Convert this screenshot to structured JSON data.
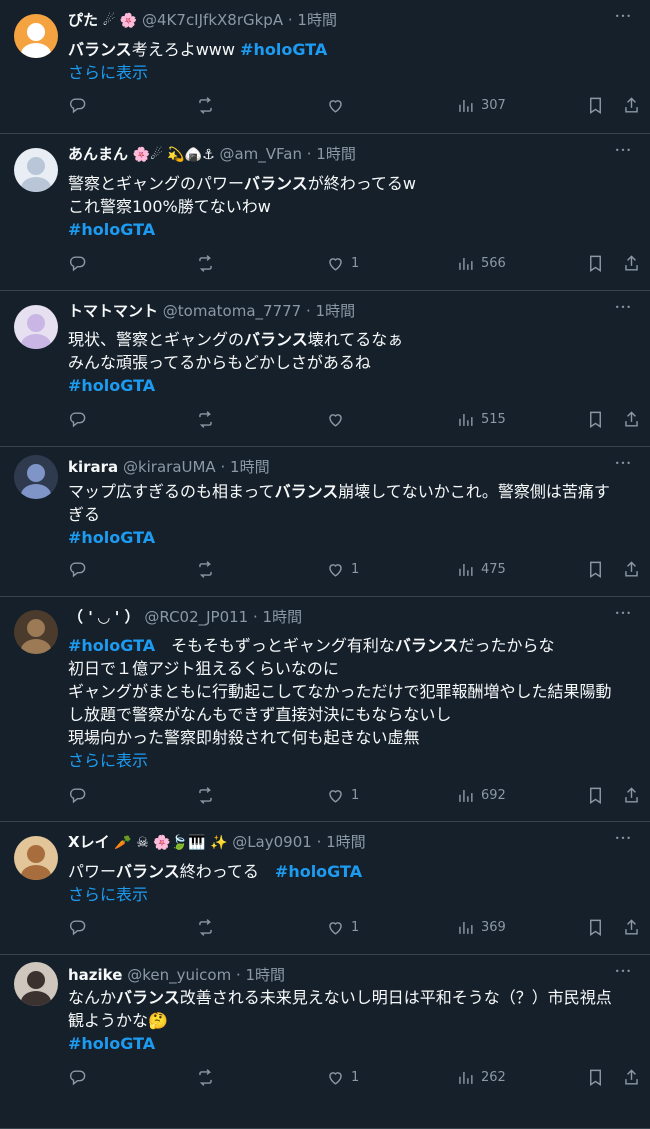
{
  "show_more_label": "さらに表示",
  "tweets": [
    {
      "name": "ぴた",
      "badges": "☄ 🌸",
      "handle": "@4K7cIJfkX8rGkpA",
      "time": "· 1時間",
      "lines": [
        [
          {
            "t": "バランス",
            "b": true
          },
          {
            "t": "考えろよwww "
          },
          {
            "t": "#holoGTA",
            "tag": true
          }
        ]
      ],
      "show_more": true,
      "replies": "",
      "likes": "",
      "views": "307"
    },
    {
      "name": "あんまん",
      "badges": "🌸☄ 💫🍙⚓",
      "handle": "@am_VFan",
      "time": "· 1時間",
      "lines": [
        [
          {
            "t": "警察とギャングのパワー"
          },
          {
            "t": "バランス",
            "b": true
          },
          {
            "t": "が終わってるw"
          }
        ],
        [
          {
            "t": "これ警察100%勝てないわw"
          }
        ],
        [
          {
            "t": " #holoGTA",
            "tag": true
          }
        ]
      ],
      "show_more": false,
      "replies": "",
      "likes": "1",
      "views": "566"
    },
    {
      "name": "トマトマント",
      "badges": "",
      "handle": "@tomatoma_7777",
      "time": "· 1時間",
      "lines": [
        [
          {
            "t": "現状、警察とギャングの"
          },
          {
            "t": "バランス",
            "b": true
          },
          {
            "t": "壊れてるなぁ"
          }
        ],
        [
          {
            "t": "みんな頑張ってるからもどかしさがあるね"
          }
        ],
        [
          {
            "t": "#holoGTA",
            "tag": true
          }
        ]
      ],
      "show_more": false,
      "replies": "",
      "likes": "",
      "views": "515"
    },
    {
      "name": "kirara",
      "badges": "",
      "handle": "@kiraraUMA",
      "time": "· 1時間",
      "lines": [
        [
          {
            "t": "マップ広すぎるのも相まって"
          },
          {
            "t": "バランス",
            "b": true
          },
          {
            "t": "崩壊してないかこれ。警察側は苦痛す"
          }
        ],
        [
          {
            "t": "ぎる"
          }
        ],
        [
          {
            "t": "#holoGTA",
            "tag": true
          }
        ]
      ],
      "show_more": false,
      "replies": "",
      "likes": "1",
      "views": "475"
    },
    {
      "name": "（ ' ◡ ' ）",
      "badges": "",
      "handle": "@RC02_JP011",
      "time": "· 1時間",
      "lines": [
        [
          {
            "t": "#holoGTA",
            "tag": true
          },
          {
            "t": "　そもそもずっとギャング有利な"
          },
          {
            "t": "バランス",
            "b": true
          },
          {
            "t": "だったからな"
          }
        ],
        [
          {
            "t": "初日で１億アジト狙えるくらいなのに"
          }
        ],
        [
          {
            "t": "ギャングがまともに行動起こしてなかっただけで犯罪報酬増やした結果陽動"
          }
        ],
        [
          {
            "t": "し放題で警察がなんもできず直接対決にもならないし"
          }
        ],
        [
          {
            "t": "現場向かった警察即射殺されて何も起きない虚無"
          }
        ]
      ],
      "show_more": true,
      "replies": "",
      "likes": "1",
      "views": "692"
    },
    {
      "name": "Xレイ",
      "badges": "🥕 ☠ 🌸🍃🎹 ✨",
      "handle": "@Lay0901",
      "time": "· 1時間",
      "lines": [
        [
          {
            "t": "パワー"
          },
          {
            "t": "バランス",
            "b": true
          },
          {
            "t": "終わってる　"
          },
          {
            "t": "#holoGTA",
            "tag": true
          }
        ]
      ],
      "show_more": true,
      "replies": "",
      "likes": "1",
      "views": "369"
    },
    {
      "name": "hazike",
      "badges": "",
      "handle": "@ken_yuicom",
      "time": "· 1時間",
      "lines": [
        [
          {
            "t": "なんか"
          },
          {
            "t": "バランス",
            "b": true
          },
          {
            "t": "改善される未来見えないし明日は平和そうな（？）市民視点"
          }
        ],
        [
          {
            "t": "観ようかな🤔"
          }
        ],
        [
          {
            "t": "#holoGTA",
            "tag": true
          }
        ]
      ],
      "show_more": false,
      "replies": "",
      "likes": "1",
      "views": "262"
    }
  ]
}
